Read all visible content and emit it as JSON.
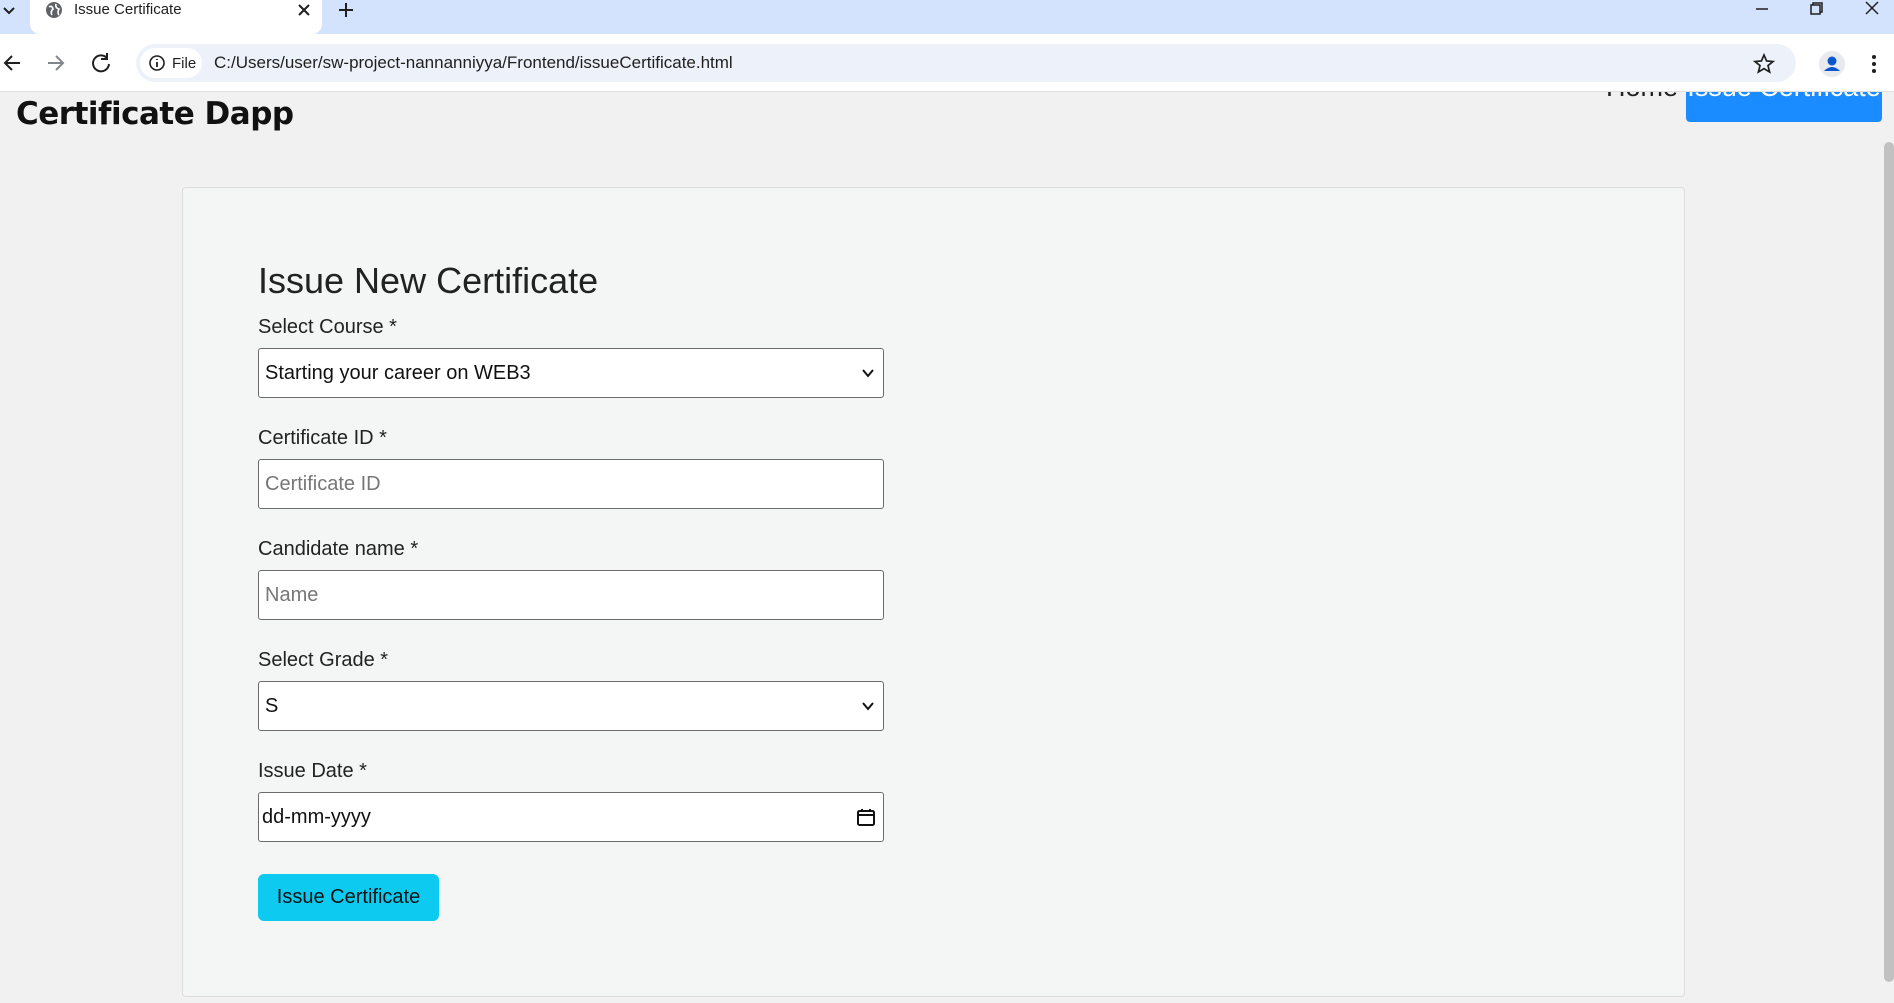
{
  "browser": {
    "tab_title": "Issue Certificate",
    "site_chip": "File",
    "url": "C:/Users/user/sw-project-nannanniyya/Frontend/issueCertificate.html"
  },
  "nav": {
    "brand": "Certificate Dapp",
    "home": "Home",
    "issue": "Issue Certificate"
  },
  "form": {
    "title": "Issue New Certificate",
    "course": {
      "label": "Select Course *",
      "value": "Starting your career on WEB3"
    },
    "cert_id": {
      "label": "Certificate ID *",
      "placeholder": "Certificate ID"
    },
    "candidate": {
      "label": "Candidate name *",
      "placeholder": "Name"
    },
    "grade": {
      "label": "Select Grade *",
      "value": "S"
    },
    "date": {
      "label": "Issue Date *",
      "value": "dd-mm-yyyy"
    },
    "submit": "Issue Certificate"
  },
  "colors": {
    "tabstrip": "#d3e3fd",
    "nav_active": "#1a8cff",
    "submit": "#0dcaf0"
  }
}
